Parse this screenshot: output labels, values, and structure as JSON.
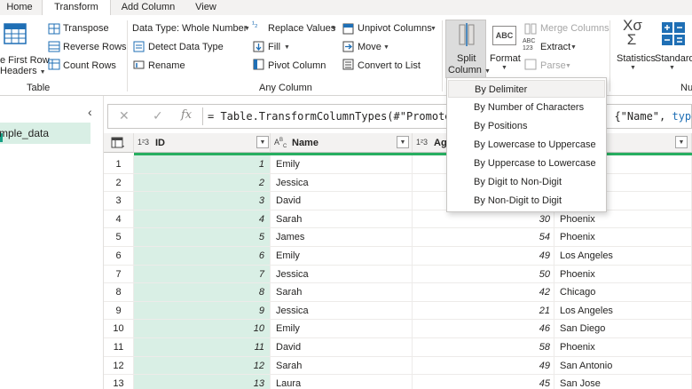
{
  "tabs": [
    "Home",
    "Transform",
    "Add Column",
    "View"
  ],
  "ribbon": {
    "table_group": {
      "first_row_line1": "e First Row",
      "first_row_line2": "Headers",
      "transpose": "Transpose",
      "reverse_rows": "Reverse Rows",
      "count_rows": "Count Rows",
      "label": "Table"
    },
    "any_column": {
      "data_type": "Data Type: Whole Number",
      "detect_type": "Detect Data Type",
      "rename": "Rename",
      "replace_values": "Replace Values",
      "fill": "Fill",
      "pivot_column": "Pivot Column",
      "unpivot": "Unpivot Columns",
      "move": "Move",
      "convert_list": "Convert to List",
      "label": "Any Column"
    },
    "text_column": {
      "split_line1": "Split",
      "split_line2": "Column",
      "format": "Format",
      "format_icon": "ABC",
      "merge_columns": "Merge Columns",
      "extract": "Extract",
      "extract_icon": "ABC\n123",
      "parse": "Parse"
    },
    "number_column": {
      "statistics": "Statistics",
      "standard": "Standard",
      "label_partial": "Nu"
    }
  },
  "queries": {
    "selected": "mple_data"
  },
  "formula": {
    "fx": "fx",
    "text": "= Table.TransformColumnTypes(#\"Promoted",
    "trail_plain": ", {\"Name\", ",
    "trail_keyword": "type"
  },
  "columns": [
    {
      "type_icon": "1²3",
      "name": "ID"
    },
    {
      "type_icon": "A^B_C",
      "name": "Name"
    },
    {
      "type_icon": "1²3",
      "name": "Ag"
    }
  ],
  "rows": [
    {
      "n": "1",
      "id": "1",
      "name": "Emily",
      "age": "",
      "city": ""
    },
    {
      "n": "2",
      "id": "2",
      "name": "Jessica",
      "age": "",
      "city": ""
    },
    {
      "n": "3",
      "id": "3",
      "name": "David",
      "age": "",
      "city": ""
    },
    {
      "n": "4",
      "id": "4",
      "name": "Sarah",
      "age": "30",
      "city": "Phoenix"
    },
    {
      "n": "5",
      "id": "5",
      "name": "James",
      "age": "54",
      "city": "Phoenix"
    },
    {
      "n": "6",
      "id": "6",
      "name": "Emily",
      "age": "49",
      "city": "Los Angeles"
    },
    {
      "n": "7",
      "id": "7",
      "name": "Jessica",
      "age": "50",
      "city": "Phoenix"
    },
    {
      "n": "8",
      "id": "8",
      "name": "Sarah",
      "age": "42",
      "city": "Chicago"
    },
    {
      "n": "9",
      "id": "9",
      "name": "Jessica",
      "age": "21",
      "city": "Los Angeles"
    },
    {
      "n": "10",
      "id": "10",
      "name": "Emily",
      "age": "46",
      "city": "San Diego"
    },
    {
      "n": "11",
      "id": "11",
      "name": "David",
      "age": "58",
      "city": "Phoenix"
    },
    {
      "n": "12",
      "id": "12",
      "name": "Sarah",
      "age": "49",
      "city": "San Antonio"
    },
    {
      "n": "13",
      "id": "13",
      "name": "Laura",
      "age": "45",
      "city": "San Jose"
    }
  ],
  "split_menu": [
    "By Delimiter",
    "By Number of Characters",
    "By Positions",
    "By Lowercase to Uppercase",
    "By Uppercase to Lowercase",
    "By Digit to Non-Digit",
    "By Non-Digit to Digit"
  ],
  "colors": {
    "accent_green": "#27ae60",
    "selected_column": "#d9efe5",
    "ribbon_bg": "#ffffff",
    "tab_bg": "#f3f2f1"
  }
}
